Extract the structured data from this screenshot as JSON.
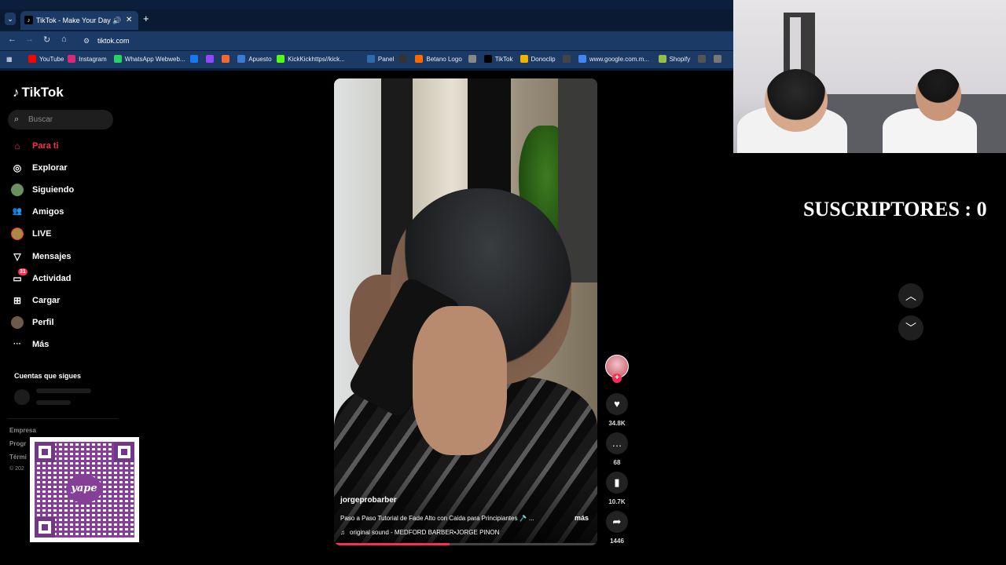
{
  "browser": {
    "tab_title": "TikTok - Make Your Day",
    "tab_close": "✕",
    "new_tab": "+",
    "url": "tiktok.com",
    "bookmarks": [
      {
        "label": "YouTube",
        "color": "#ff0000"
      },
      {
        "label": "Instagram",
        "color": "#d62976"
      },
      {
        "label": "WhatsApp Webweb...",
        "color": "#25d366"
      },
      {
        "label": "",
        "color": "#1877f2"
      },
      {
        "label": "",
        "color": "#9146ff"
      },
      {
        "label": "",
        "color": "#f06a35"
      },
      {
        "label": "Apuesto",
        "color": "#3a7bd5"
      },
      {
        "label": "KickKickhttps//kick...",
        "color": "#53fc18"
      },
      {
        "label": "Panel",
        "color": "#2b6cb0"
      },
      {
        "label": "",
        "color": "#333333"
      },
      {
        "label": "Betano Logo",
        "color": "#ff6a00"
      },
      {
        "label": "",
        "color": "#888888"
      },
      {
        "label": "TikTok",
        "color": "#000000"
      },
      {
        "label": "Donoclip",
        "color": "#f0b400"
      },
      {
        "label": "",
        "color": "#444444"
      },
      {
        "label": "www.google.com.m...",
        "color": "#4285f4"
      },
      {
        "label": "Shopify",
        "color": "#95bf47"
      },
      {
        "label": "",
        "color": "#555555"
      },
      {
        "label": "",
        "color": "#777777"
      }
    ]
  },
  "sidebar": {
    "logo": "TikTok",
    "search_placeholder": "Buscar",
    "items": [
      {
        "label": "Para ti",
        "icon": "⌂"
      },
      {
        "label": "Explorar",
        "icon": "◎"
      },
      {
        "label": "Siguiendo",
        "icon": "●"
      },
      {
        "label": "Amigos",
        "icon": "👥"
      },
      {
        "label": "LIVE",
        "icon": "●"
      },
      {
        "label": "Mensajes",
        "icon": "▽"
      },
      {
        "label": "Actividad",
        "icon": "▭",
        "badge": "31"
      },
      {
        "label": "Cargar",
        "icon": "⊞"
      },
      {
        "label": "Perfil",
        "icon": "●"
      },
      {
        "label": "Más",
        "icon": "···"
      }
    ],
    "following_header": "Cuentas que sigues",
    "footer": [
      "Empresa",
      "Progr",
      "Térmi",
      "© 202"
    ]
  },
  "qr": {
    "brand": "yape"
  },
  "video": {
    "username": "jorgeprobarber",
    "description": "Paso a Paso Tutorial de Fade Alto con Caida para Principiantes 🪒 ...",
    "more": "más",
    "sound": "original sound - MEDFORD BARBER•JORGE PINON",
    "progress": 0.44
  },
  "actions": {
    "likes": "34.8K",
    "comments": "68",
    "saves": "10.7K",
    "shares": "1446"
  },
  "overlay": {
    "subscribers": "SUSCRIPTORES : 0"
  },
  "colors": {
    "accent": "#fe2c55",
    "chrome": "#1c3a66"
  }
}
